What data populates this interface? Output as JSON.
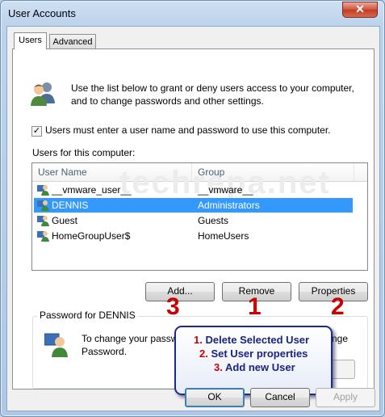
{
  "window": {
    "title": "User Accounts",
    "close_glyph": "✕"
  },
  "tabs": [
    {
      "label": "Users"
    },
    {
      "label": "Advanced"
    }
  ],
  "intro": "Use the list below to grant or deny users access to your computer, and to change passwords and other settings.",
  "checkbox": {
    "label": "Users must enter a user name and password to use this computer.",
    "checked": true,
    "mark": "✓"
  },
  "list": {
    "label": "Users for this computer:",
    "columns": {
      "user_name": "User Name",
      "group": "Group"
    },
    "watermark": "techrepa.net",
    "rows": [
      {
        "name": "__vmware_user__",
        "group": "__vmware__"
      },
      {
        "name": "DENNIS",
        "group": "Administrators",
        "selected": true
      },
      {
        "name": "Guest",
        "group": "Guests"
      },
      {
        "name": "HomeGroupUser$",
        "group": "HomeUsers"
      }
    ]
  },
  "buttons": {
    "add": "Add...",
    "remove": "Remove",
    "properties": "Properties",
    "ok": "OK",
    "cancel": "Cancel",
    "apply": "Apply"
  },
  "annotation_numbers": {
    "add": "3",
    "remove": "1",
    "properties": "2"
  },
  "password_group": {
    "title": "Password for DENNIS",
    "text_line1": "To change your password, press Ctrl+Alt+Del and select Change",
    "text_line2": "Password.",
    "text_visible_right": "nge"
  },
  "callout": {
    "items": [
      {
        "num": "1.",
        "text": "Delete Selected User"
      },
      {
        "num": "2.",
        "text": "Set User properties"
      },
      {
        "num": "3.",
        "text": "Add new User"
      }
    ]
  },
  "colors": {
    "selection": "#3399ff",
    "annotation_red": "#cc0000",
    "callout_border": "#1c2a8a"
  },
  "icons": {
    "users": "users-icon",
    "user": "user-icon",
    "password": "user-password-icon",
    "close": "close-icon",
    "check": "checkmark-icon"
  }
}
